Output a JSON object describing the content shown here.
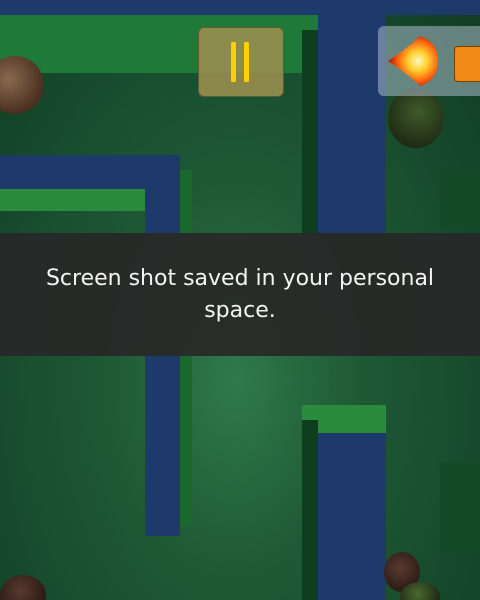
{
  "toast": {
    "message": "Screen shot saved in your personal space."
  },
  "hud": {
    "pause_icon": "pause-icon",
    "fire_icon": "fireball-icon"
  },
  "colors": {
    "wall_top": "#1d3a6a",
    "wall_face": "#1a6a30",
    "floor": "#1f5a36",
    "pause_bars": "#ffd000",
    "fire_button_accent": "#f08a14",
    "toast_bg": "#282828"
  }
}
